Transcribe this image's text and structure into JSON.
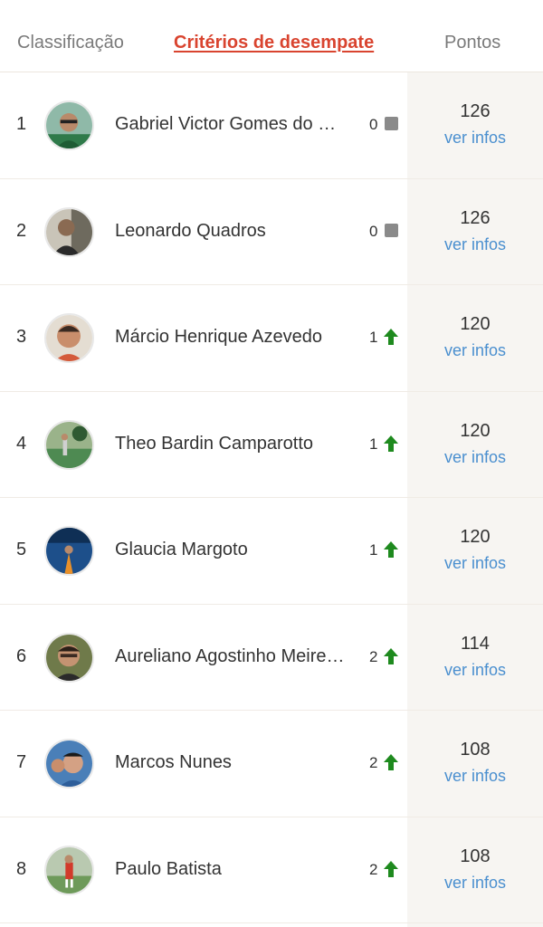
{
  "header": {
    "tab_classification": "Classificação",
    "tab_tiebreak": "Critérios de desempate",
    "col_points": "Pontos"
  },
  "colors": {
    "accent": "#d9442f",
    "link": "#4a8fcf",
    "up_arrow": "#1e8a1e",
    "neutral_square": "#8a8a8a"
  },
  "players": [
    {
      "rank": "1",
      "name": "Gabriel Victor Gomes do Nascimento",
      "change": "0",
      "trend": "same",
      "points": "126",
      "info": "ver infos"
    },
    {
      "rank": "2",
      "name": "Leonardo Quadros",
      "change": "0",
      "trend": "same",
      "points": "126",
      "info": "ver infos"
    },
    {
      "rank": "3",
      "name": "Márcio Henrique Azevedo",
      "change": "1",
      "trend": "up",
      "points": "120",
      "info": "ver infos"
    },
    {
      "rank": "4",
      "name": "Theo Bardin Camparotto",
      "change": "1",
      "trend": "up",
      "points": "120",
      "info": "ver infos"
    },
    {
      "rank": "5",
      "name": "Glaucia Margoto",
      "change": "1",
      "trend": "up",
      "points": "120",
      "info": "ver infos"
    },
    {
      "rank": "6",
      "name": "Aureliano Agostinho Meireles",
      "change": "2",
      "trend": "up",
      "points": "114",
      "info": "ver infos"
    },
    {
      "rank": "7",
      "name": "Marcos Nunes",
      "change": "2",
      "trend": "up",
      "points": "108",
      "info": "ver infos"
    },
    {
      "rank": "8",
      "name": "Paulo Batista",
      "change": "2",
      "trend": "up",
      "points": "108",
      "info": "ver infos"
    }
  ]
}
